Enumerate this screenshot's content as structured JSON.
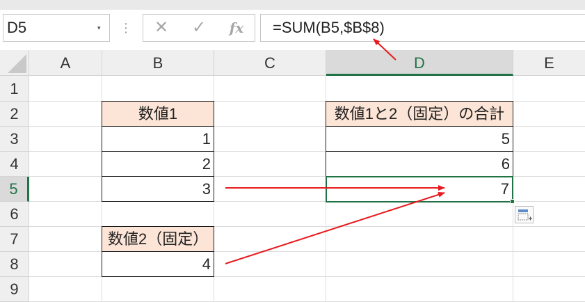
{
  "name_box": {
    "value": "D5",
    "arrow": "▾"
  },
  "formula_bar": {
    "dots": "⋮",
    "cancel": "✕",
    "enter": "✓",
    "fx": "fx",
    "formula": "=SUM(B5,$B$8)"
  },
  "columns": [
    "A",
    "B",
    "C",
    "D",
    "E"
  ],
  "rows": [
    "1",
    "2",
    "3",
    "4",
    "5",
    "6",
    "7",
    "8",
    "9"
  ],
  "cells": {
    "B2": "数値1",
    "B3": "1",
    "B4": "2",
    "B5": "3",
    "B7": "数値2（固定）",
    "B8": "4",
    "D2": "数値1と2（固定）の合計",
    "D3": "5",
    "D4": "6",
    "D5": "7"
  },
  "selected_cell": "D5",
  "colors": {
    "accent": "#217346",
    "header_fill": "#fce4d6",
    "arrow": "#e8191c"
  }
}
